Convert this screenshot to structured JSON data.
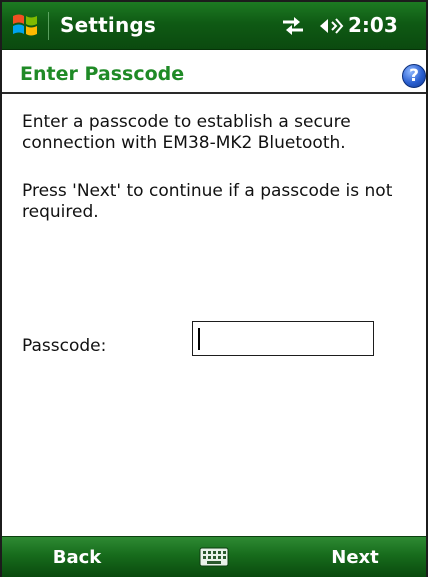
{
  "status_bar": {
    "app_title": "Settings",
    "time": "2:03",
    "icons": [
      "windows-start-icon",
      "connectivity-icon",
      "volume-icon"
    ]
  },
  "header": {
    "title": "Enter Passcode",
    "help_icon": "help-icon",
    "help_glyph": "?"
  },
  "content": {
    "intro": "Enter a passcode to establish a secure connection with EM38-MK2 Bluetooth.",
    "skip_note": "Press 'Next' to continue if a passcode is not required.",
    "passcode_label": "Passcode:",
    "passcode_value": ""
  },
  "softkeys": {
    "left": "Back",
    "right": "Next",
    "center_icon": "keyboard-icon"
  },
  "colors": {
    "title_bar": "#0f5a14",
    "header_text": "#1f8a26",
    "softkey_bar": "#176c1c",
    "help_icon": "#2a5fd0"
  }
}
